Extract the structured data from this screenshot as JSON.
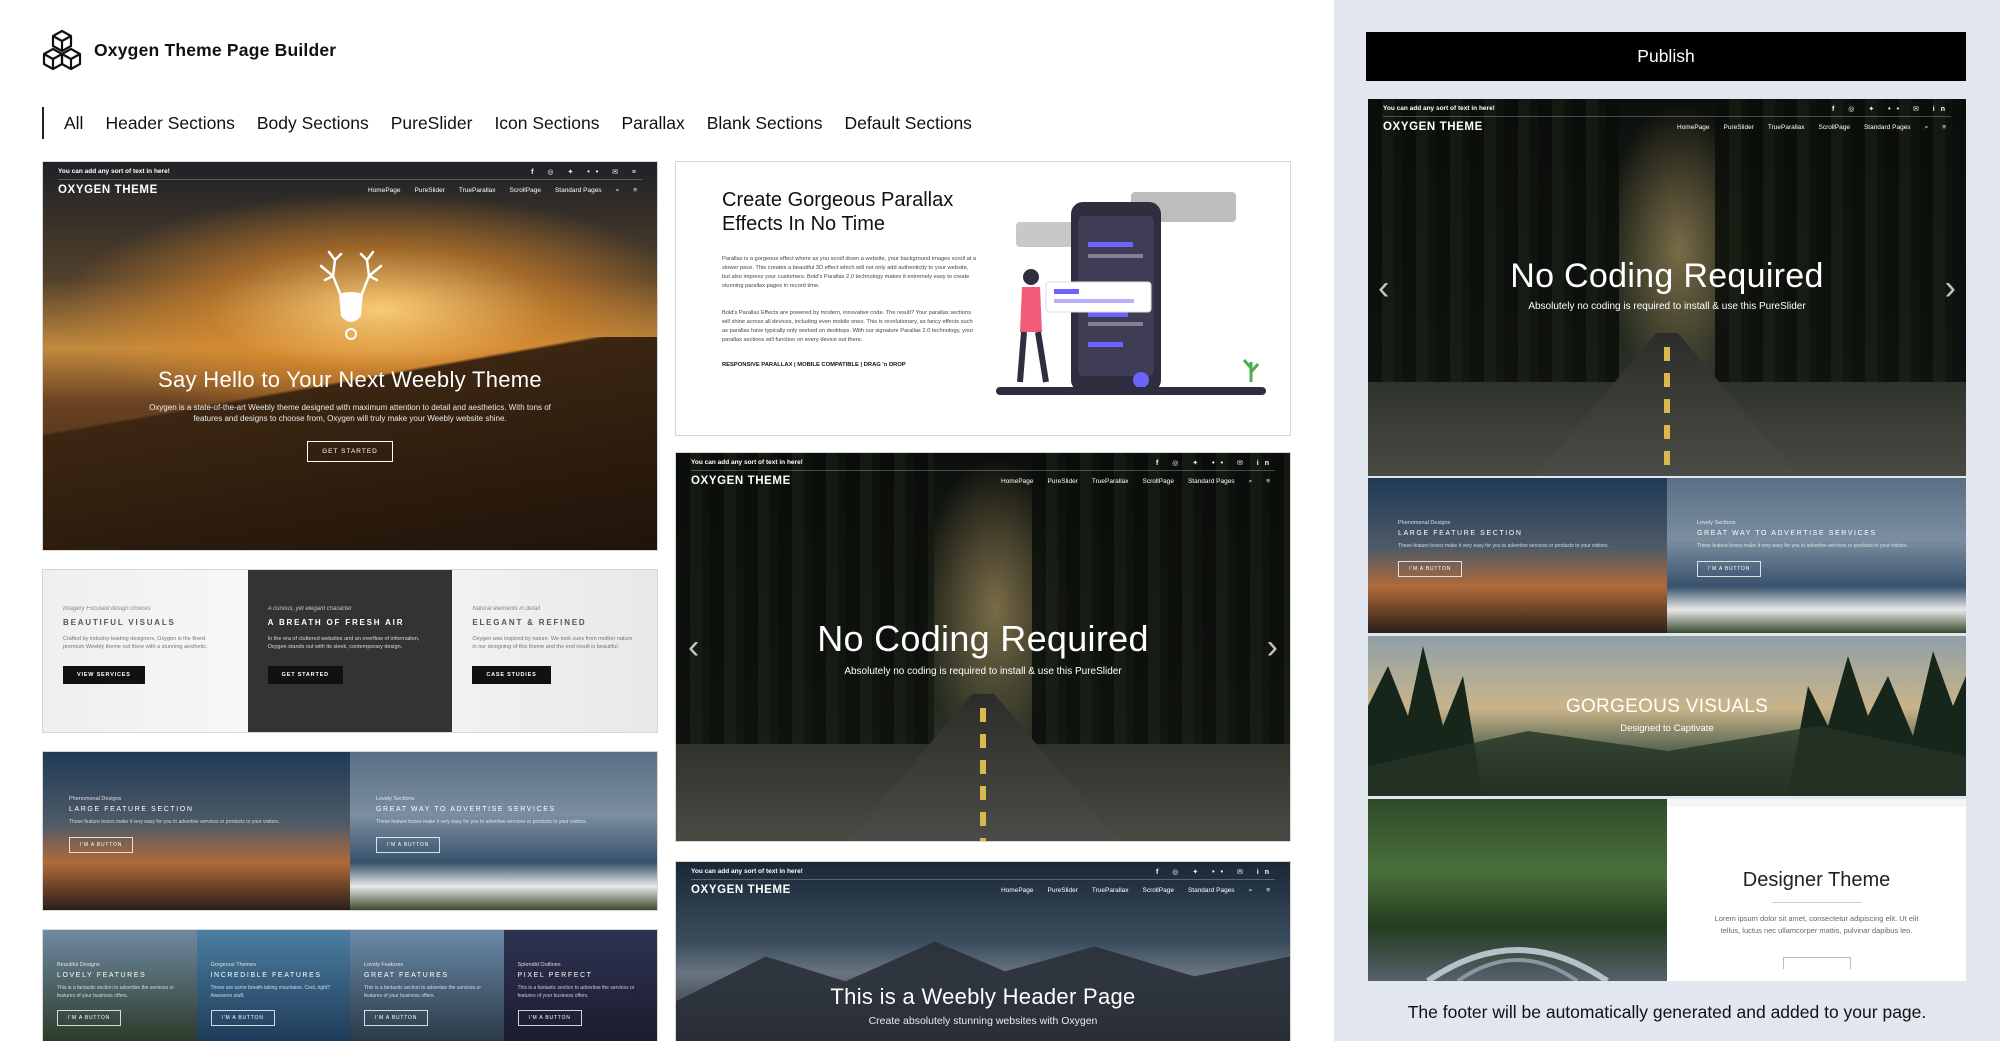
{
  "app": {
    "title": "Oxygen Theme Page Builder"
  },
  "tabs": [
    "All",
    "Header Sections",
    "Body Sections",
    "PureSlider",
    "Icon Sections",
    "Parallax",
    "Blank Sections",
    "Default Sections"
  ],
  "mini_nav": {
    "topline": "You can add any sort of text in here!",
    "logo": "OXYGEN THEME",
    "links": [
      "HomePage",
      "PureSlider",
      "TrueParallax",
      "ScrollPage",
      "Standard Pages"
    ]
  },
  "thumbs": {
    "hero": {
      "title": "Say Hello to Your Next Weebly Theme",
      "body": "Oxygen is a state-of-the-art Weebly theme designed with maximum attention to detail and aesthetics. With tons of features and designs to choose from, Oxygen will truly make your Weebly website shine.",
      "button": "GET STARTED"
    },
    "parallax": {
      "title": "Create Gorgeous Parallax Effects In No Time",
      "body1": "Parallax is a gorgeous effect where as you scroll down a website, your background images scroll at a slower pace. This creates a beautiful 3D effect which will not only add authenticity to your website, but also impress your customers. Bold's Parallax 2.0 technology makes it extremely easy to create stunning parallax pages in record time.",
      "body2": "Bold's Parallax Effects are powered by modern, innovative code. The result? Your parallax sections will shine across all devices, including even mobile ones. This is revolutionary, as fancy effects such as parallax have typically only worked on desktops. With our signature Parallax 2.0 technology, your parallax sections will function on every device out there.",
      "tagline": "RESPONSIVE PARALLAX | MOBILE COMPATIBLE | DRAG 'n DROP"
    },
    "three_col": [
      {
        "small": "Imagery Focused design choices",
        "cap": "BEAUTIFUL VISUALS",
        "body": "Crafted by industry-leading designers, Oxygen is the finest premium Weebly theme out there with a stunning aesthetic.",
        "button": "VIEW SERVICES"
      },
      {
        "small": "A curious, yet elegant character",
        "cap": "A BREATH OF FRESH AIR",
        "body": "In the era of cluttered websites and an overflow of information, Oxygen stands out with its sleek, contemporary design.",
        "button": "GET STARTED"
      },
      {
        "small": "Natural elements in detail",
        "cap": "ELEGANT & REFINED",
        "body": "Oxygen was inspired by nature. We took cues from mother nature in our designing of this theme and the end result is beautiful.",
        "button": "CASE STUDIES"
      }
    ],
    "slider": {
      "title": "No Coding Required",
      "subtitle": "Absolutely no coding is required to install & use this PureSlider"
    },
    "feature_pair": [
      {
        "small": "Phenomenal Designs",
        "cap": "LARGE FEATURE SECTION",
        "body": "These feature boxes make it very easy for you to advertise services or products to your visitors.",
        "button": "I'M A BUTTON"
      },
      {
        "small": "Lovely Sections",
        "cap": "GREAT WAY TO ADVERTISE SERVICES",
        "body": "These feature boxes make it very easy for you to advertise services or products to your visitors.",
        "button": "I'M A BUTTON"
      }
    ],
    "feature_four": [
      {
        "small": "Beautiful Designs",
        "cap": "LOVELY FEATURES",
        "body": "This is a fantastic section to advertise the services or features of your business offers.",
        "button": "I'M A BUTTON"
      },
      {
        "small": "Gorgeous Themes",
        "cap": "INCREDIBLE FEATURES",
        "body": "These are some breath-taking mountains. Cool, right? Awesome stuff.",
        "button": "I'M A BUTTON"
      },
      {
        "small": "Lovely Features",
        "cap": "GREAT FEATURES",
        "body": "This is a fantastic section to advertise the services or features of your business offers.",
        "button": "I'M A BUTTON"
      },
      {
        "small": "Splendid Outlines",
        "cap": "PIXEL PERFECT",
        "body": "This is a fantastic section to advertise the services or features of your business offers.",
        "button": "I'M A BUTTON"
      }
    ],
    "header_page": {
      "title": "This is a Weebly Header Page",
      "subtitle": "Create absolutely stunning websites with Oxygen"
    }
  },
  "preview": {
    "publish_label": "Publish",
    "slider_title": "No Coding Required",
    "slider_subtitle": "Absolutely no coding is required to install & use this PureSlider",
    "gorgeous_title": "GORGEOUS VISUALS",
    "gorgeous_subtitle": "Designed to Captivate",
    "designer_title": "Designer Theme",
    "designer_body": "Lorem ipsum dolor sit amet, consectetur adipiscing elit. Ut elit tellus, luctus nec ullamcorper mattis, pulvinar dapibus leo.",
    "footer_note": "The footer will be automatically generated and added to your page."
  },
  "colors": {
    "side_bg": "#e1e6ef",
    "publish_bg": "#000000",
    "accent_purple": "#6c63ff"
  },
  "icons": [
    "cube-logo-icon",
    "facebook-icon",
    "instagram-icon",
    "twitter-icon",
    "flickr-icon",
    "email-icon",
    "linkedin-icon",
    "search-icon",
    "menu-icon",
    "chevron-left-icon",
    "chevron-right-icon"
  ]
}
